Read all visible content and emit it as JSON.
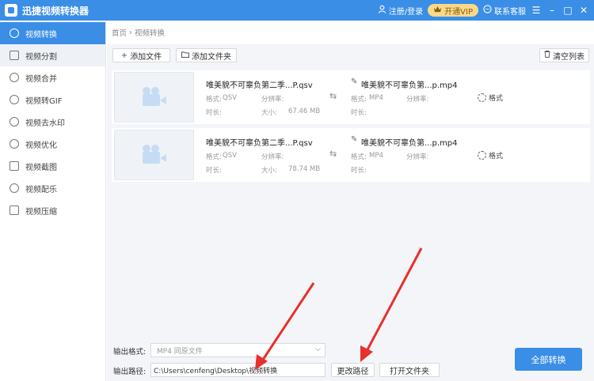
{
  "titlebar": {
    "app_title": "迅捷视频转换器",
    "login": "注册/登录",
    "vip": "开通VIP",
    "service": "联系客服",
    "icons": [
      "user-icon",
      "crown-icon",
      "chat-icon",
      "menu-icon",
      "minimize-icon",
      "maximize-icon",
      "close-icon"
    ]
  },
  "sidebar": {
    "items": [
      {
        "label": "视频转换",
        "icon": "convert-icon"
      },
      {
        "label": "视频分割",
        "icon": "split-icon"
      },
      {
        "label": "视频合并",
        "icon": "merge-icon"
      },
      {
        "label": "视频转GIF",
        "icon": "gif-icon"
      },
      {
        "label": "视频去水印",
        "icon": "watermark-icon"
      },
      {
        "label": "视频优化",
        "icon": "optimize-icon"
      },
      {
        "label": "视频截图",
        "icon": "screenshot-icon"
      },
      {
        "label": "视频配乐",
        "icon": "music-icon"
      },
      {
        "label": "视频压缩",
        "icon": "compress-icon"
      }
    ]
  },
  "breadcrumb": {
    "home": "首页",
    "sep": "›",
    "current": "视频转换"
  },
  "toolbar": {
    "add_file": "添加文件",
    "add_folder": "添加文件夹",
    "clear_list": "清空列表"
  },
  "files": [
    {
      "source_name": "唯美貌不可辜负第二季...P.qsv",
      "format_label": "格式:",
      "format_value": "QSV",
      "resolution_label": "分辨率:",
      "resolution_value": "",
      "duration_label": "时长:",
      "duration_value": "",
      "size_label": "大小:",
      "size_value": "67.46 MB",
      "output_name": "唯美貌不可辜负第...p.mp4",
      "out_format_label": "格式:",
      "out_format_value": "MP4",
      "out_resolution_label": "分辨率:",
      "out_duration_label": "时长:",
      "format_button": "格式"
    },
    {
      "source_name": "唯美貌不可辜负第二季...P.qsv",
      "format_label": "格式:",
      "format_value": "QSV",
      "resolution_label": "分辨率:",
      "resolution_value": "",
      "duration_label": "时长:",
      "duration_value": "",
      "size_label": "大小:",
      "size_value": "78.74 MB",
      "output_name": "唯美貌不可辜负第...p.mp4",
      "out_format_label": "格式:",
      "out_format_value": "MP4",
      "out_resolution_label": "分辨率:",
      "out_duration_label": "时长:",
      "format_button": "格式"
    }
  ],
  "output": {
    "format_label": "输出格式:",
    "format_value": "MP4   同原文件",
    "path_label": "输出路径:",
    "path_value": "C:\\Users\\cenfeng\\Desktop\\视频转换",
    "change_path": "更改路径",
    "open_folder": "打开文件夹",
    "convert_all": "全部转换"
  },
  "colors": {
    "accent": "#3a8ee6",
    "vip": "#f9d98a",
    "annotation": "#e8302c"
  }
}
